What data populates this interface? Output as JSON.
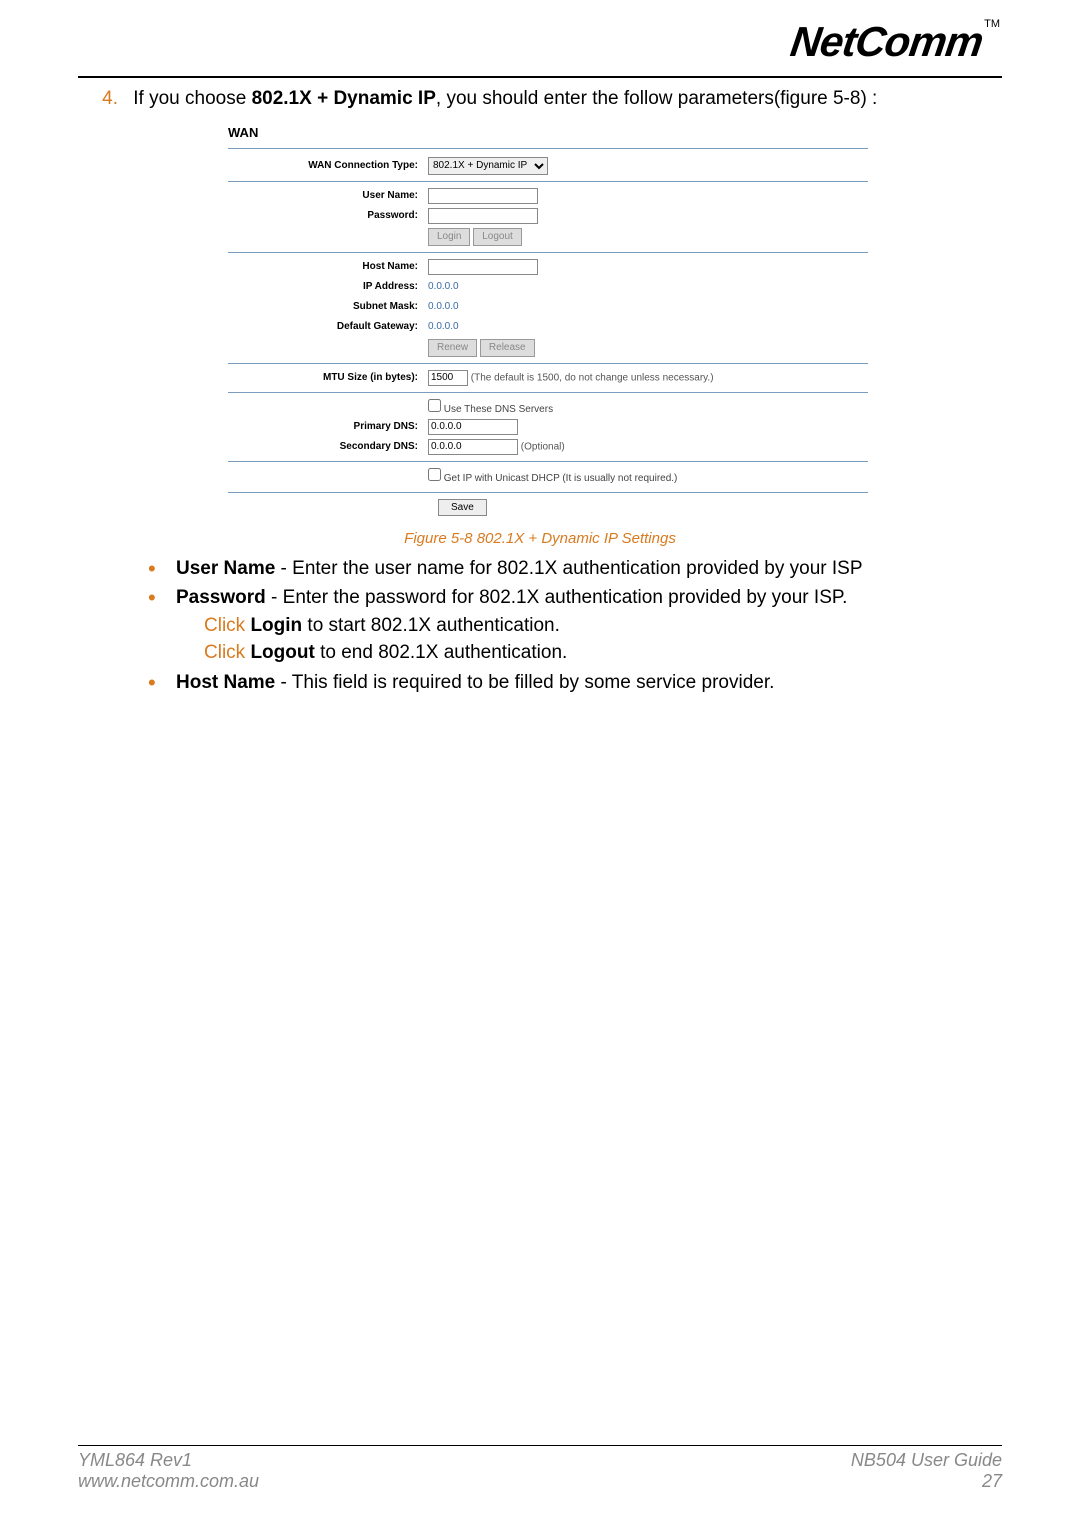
{
  "logo": "NetComm",
  "logo_tm": "TM",
  "step_number": "4.",
  "step_text_prefix": "If you choose ",
  "step_bold": "802.1X + Dynamic IP",
  "step_text_suffix": ", you should enter the follow parameters(figure 5-8) :",
  "wan": {
    "title": "WAN",
    "conn_type_label": "WAN Connection Type:",
    "conn_type_value": "802.1X + Dynamic IP",
    "user_name_label": "User Name:",
    "user_name_value": "",
    "password_label": "Password:",
    "password_value": "",
    "login_btn": "Login",
    "logout_btn": "Logout",
    "host_name_label": "Host Name:",
    "host_name_value": "",
    "ip_label": "IP Address:",
    "ip_value": "0.0.0.0",
    "subnet_label": "Subnet Mask:",
    "subnet_value": "0.0.0.0",
    "gateway_label": "Default Gateway:",
    "gateway_value": "0.0.0.0",
    "renew_btn": "Renew",
    "release_btn": "Release",
    "mtu_label": "MTU Size (in bytes):",
    "mtu_value": "1500",
    "mtu_hint": "(The default is 1500, do not change unless necessary.)",
    "use_dns_label": "Use These DNS Servers",
    "primary_dns_label": "Primary DNS:",
    "primary_dns_value": "0.0.0.0",
    "secondary_dns_label": "Secondary DNS:",
    "secondary_dns_value": "0.0.0.0",
    "optional": "(Optional)",
    "unicast_label": "Get IP with Unicast DHCP (It is usually not required.)",
    "save_btn": "Save"
  },
  "caption": "Figure 5-8 802.1X + Dynamic IP Settings",
  "bullets": {
    "b1_term": "User Name",
    "b1_text": " - Enter the user name for 802.1X authentication provided by your ISP",
    "b2_term": "Password",
    "b2_text": " - Enter the password for 802.1X authentication provided by your ISP.",
    "b2_sub1a": "Click ",
    "b2_sub1b": "Login",
    "b2_sub1c": " to start 802.1X authentication.",
    "b2_sub2a": "Click ",
    "b2_sub2b": "Logout",
    "b2_sub2c": " to end 802.1X authentication.",
    "b3_term": "Host Name",
    "b3_text": " - This field is required to be filled by some service provider."
  },
  "footer": {
    "left1": "YML864 Rev1",
    "left2": "www.netcomm.com.au",
    "right1": "NB504 User Guide",
    "right2": "27"
  }
}
